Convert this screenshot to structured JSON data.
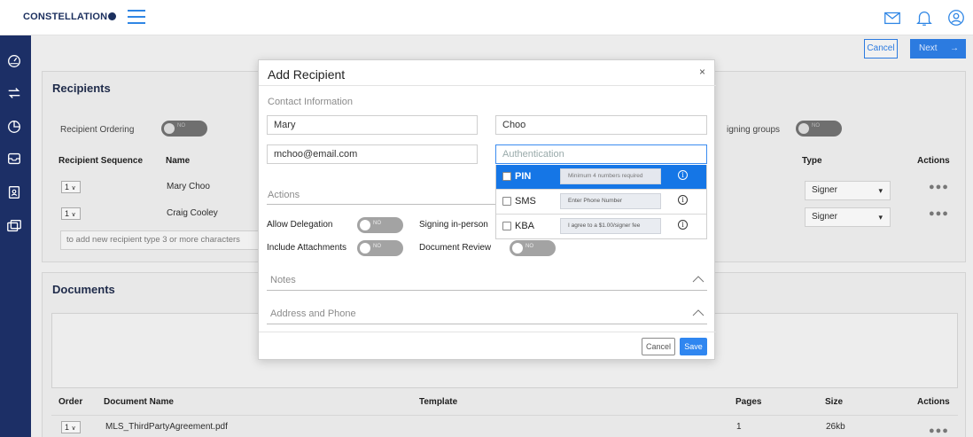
{
  "brand": {
    "logo_text": "CONSTELLATION"
  },
  "topbar": {
    "icons": [
      "mail-icon",
      "bell-icon",
      "user-icon"
    ]
  },
  "leftnav": {
    "icons": [
      "dashboard-icon",
      "transfer-icon",
      "chart-icon",
      "inbox-icon",
      "contacts-icon",
      "documents-icon"
    ]
  },
  "background": {
    "buttons": {
      "cancel": "Cancel",
      "next": "Next"
    },
    "recipients": {
      "title": "Recipients",
      "ordering_label": "Recipient Ordering",
      "ordering_toggle": "NO",
      "signing_groups_label": "igning groups",
      "signing_groups_toggle": "NO",
      "col_sequence": "Recipient Sequence",
      "col_name": "Name",
      "col_type": "Type",
      "col_actions": "Actions",
      "rows": [
        {
          "seq": "1",
          "name": "Mary Choo",
          "type": "Signer"
        },
        {
          "seq": "1",
          "name": "Craig Cooley",
          "type": "Signer"
        }
      ],
      "add_placeholder": "to add new recipient type 3 or more characters"
    },
    "documents": {
      "title": "Documents",
      "col_order": "Order",
      "col_name": "Document Name",
      "col_template": "Template",
      "col_pages": "Pages",
      "col_size": "Size",
      "col_actions": "Actions",
      "rows": [
        {
          "order": "1",
          "name": "MLS_ThirdPartyAgreement.pdf",
          "pages": "1",
          "size": "26kb"
        }
      ]
    }
  },
  "modal": {
    "title": "Add Recipient",
    "close": "×",
    "contact_section": "Contact Information",
    "first_name": "Mary",
    "last_name": "Choo",
    "email": "mchoo@email.com",
    "auth_placeholder": "Authentication",
    "auth_options": [
      {
        "name": "PIN",
        "input": "Minimum 4 numbers required",
        "selected": true
      },
      {
        "name": "SMS",
        "input": "Enter Phone Number",
        "selected": false
      },
      {
        "name": "KBA",
        "input": "I agree to a $1.00/signer fee",
        "selected": false
      }
    ],
    "actions_section": "Actions",
    "allow_delegation": "Allow Delegation",
    "include_attachments": "Include Attachments",
    "signing_in_person": "Signing in-person",
    "document_review": "Document Review",
    "toggle_no": "NO",
    "notes_section": "Notes",
    "address_section": "Address and Phone",
    "cancel": "Cancel",
    "save": "Save"
  }
}
